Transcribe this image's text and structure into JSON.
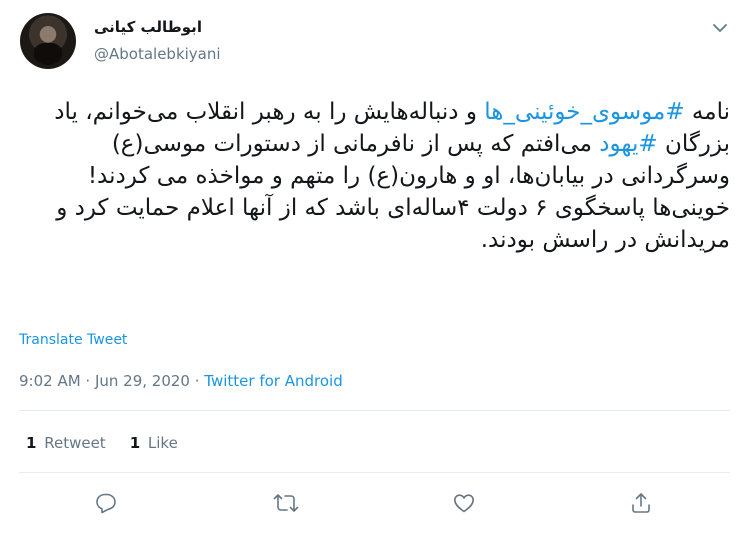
{
  "user": {
    "display_name": "ابوطالب کیانی",
    "handle": "@Abotalebkiyani"
  },
  "tweet": {
    "paragraph1": [
      {
        "text": "نامه ",
        "hashtag": false
      },
      {
        "text": "#موسوی_خوئینی_ها",
        "hashtag": true
      },
      {
        "text": " و دنباله‌هایش را به رهبر انقلاب می‌خوانم، یاد بزرگان ",
        "hashtag": false
      },
      {
        "text": "#یهود",
        "hashtag": true
      },
      {
        "text": " می‌افتم که پس از نافرمانی از دستورات موسی(ع) وسرگردانی در بیابان‌ها، او و هارون(ع) را متهم و مواخذه می کردند!",
        "hashtag": false
      }
    ],
    "paragraph2": "خوینی‌ها پاسخگوی ۶ دولت ۴ساله‌ای باشد که از آنها اعلام حمایت کرد و مریدانش در راسش بودند."
  },
  "translate_label": "Translate Tweet",
  "meta": {
    "time": "9:02 AM",
    "separator": " · ",
    "date": "Jun 29, 2020",
    "source": "Twitter for Android"
  },
  "stats": {
    "retweets_count": "1",
    "retweets_label": "Retweet",
    "likes_count": "1",
    "likes_label": "Like"
  },
  "colors": {
    "link": "#1b95e0",
    "secondary": "#657786",
    "text": "#14171a"
  },
  "icons": {
    "reply": "reply-icon",
    "retweet": "retweet-icon",
    "like": "heart-icon",
    "share": "share-icon",
    "caret": "chevron-down-icon"
  }
}
